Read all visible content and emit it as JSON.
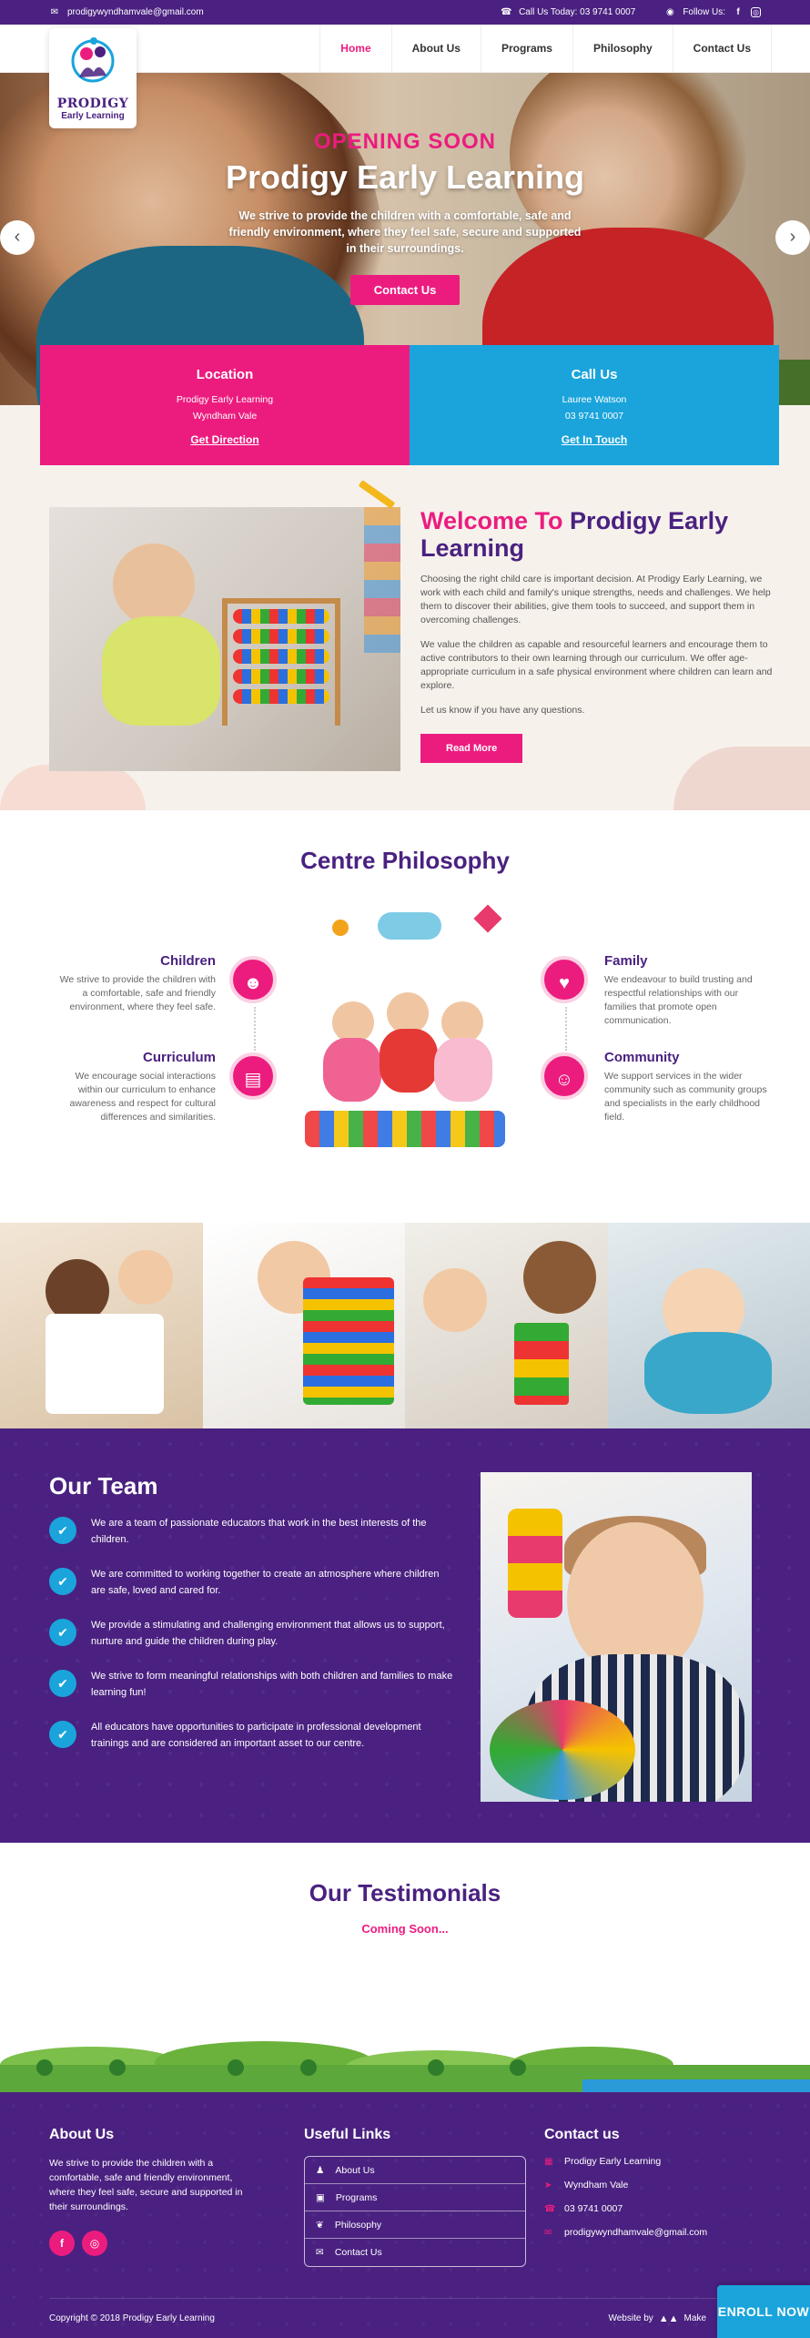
{
  "topbar": {
    "email": "prodigywyndhamvale@gmail.com",
    "call": "Call Us Today: 03 9741 0007",
    "follow": "Follow Us:"
  },
  "logo": {
    "name": "PRODIGY",
    "sub": "Early Learning"
  },
  "nav": {
    "items": [
      "Home",
      "About Us",
      "Programs",
      "Philosophy",
      "Contact Us"
    ],
    "active": "Home"
  },
  "hero": {
    "opening": "OPENING SOON",
    "title": "Prodigy Early Learning",
    "text": "We strive to provide the children with a comfortable, safe and friendly environment, where they feel safe, secure and supported in their surroundings.",
    "button": "Contact Us"
  },
  "cards": [
    {
      "title": "Location",
      "line1": "Prodigy Early Learning",
      "line2": "Wyndham Vale",
      "link": "Get Direction"
    },
    {
      "title": "Call Us",
      "line1": "Lauree Watson",
      "line2": "03 9741 0007",
      "link": "Get In Touch"
    }
  ],
  "welcome": {
    "title_a": "Welcome To",
    "title_b": "Prodigy Early Learning",
    "p1": "Choosing the right child care is important decision. At Prodigy Early Learning, we work with each child and family's unique strengths, needs and challenges. We help them to discover their abilities, give them tools to succeed, and support them in overcoming challenges.",
    "p2": "We value the children as capable and resourceful learners and encourage them to active contributors to their own learning through our curriculum. We offer age-appropriate curriculum in a safe physical environment where children can learn and explore.",
    "p3": "Let us know if you have any questions.",
    "button": "Read More"
  },
  "philosophy": {
    "title": "Centre Philosophy",
    "children_title": "Children",
    "children_text": "We strive to provide the children with a comfortable, safe and friendly environment, where they feel safe.",
    "curriculum_title": "Curriculum",
    "curriculum_text": "We encourage social interactions within our curriculum to enhance awareness and respect for cultural differences and similarities.",
    "family_title": "Family",
    "family_text": "We endeavour to build trusting and respectful relationships with our families that promote open communication.",
    "community_title": "Community",
    "community_text": "We support services in the wider community such as community groups and specialists in the early childhood field."
  },
  "team": {
    "title": "Our Team",
    "items": [
      "We are a team of passionate educators that work in the best interests of the children.",
      "We are committed to working together to create an atmosphere where children are safe, loved and cared for.",
      "We provide a stimulating and challenging environment that allows us to support, nurture and guide the children during play.",
      "We strive to form meaningful relationships with both children and families to make learning fun!",
      "All educators have opportunities to participate in professional development trainings and are considered an important asset to our centre."
    ]
  },
  "testimonials": {
    "title": "Our Testimonials",
    "soon": "Coming Soon..."
  },
  "footer": {
    "about_title": "About Us",
    "about_text": "We strive to provide the children with a comfortable, safe and friendly environment, where they feel safe, secure and supported in their surroundings.",
    "links_title": "Useful Links",
    "links": [
      "About Us",
      "Programs",
      "Philosophy",
      "Contact Us"
    ],
    "contact_title": "Contact us",
    "contact": [
      "Prodigy Early Learning",
      "Wyndham Vale",
      "03 9741 0007",
      "prodigywyndhamvale@gmail.com"
    ],
    "copyright": "Copyright © 2018 Prodigy Early Learning",
    "website_by": "Website by",
    "maker": "Make",
    "enroll": "ENROLL NOW"
  },
  "colors": {
    "purple": "#4a2180",
    "pink": "#ec1c7f",
    "blue": "#1aa4db"
  }
}
